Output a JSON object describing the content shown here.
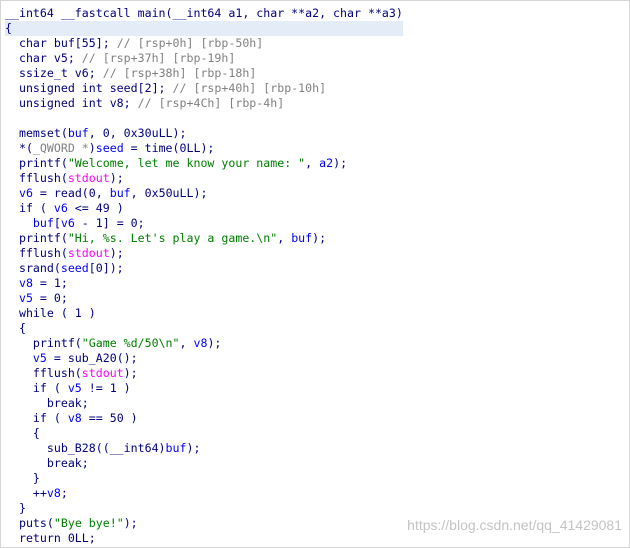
{
  "code": {
    "lines": [
      [
        [
          "p",
          "__int64 __fastcall main(__int64 a1, char **a2, char **a3)"
        ]
      ],
      [
        [
          "p",
          "{"
        ]
      ],
      [
        [
          "p",
          "  char buf[55]; "
        ],
        [
          "c",
          "// [rsp+0h] [rbp-50h]"
        ]
      ],
      [
        [
          "p",
          "  char v5; "
        ],
        [
          "c",
          "// [rsp+37h] [rbp-19h]"
        ]
      ],
      [
        [
          "p",
          "  ssize_t v6; "
        ],
        [
          "c",
          "// [rsp+38h] [rbp-18h]"
        ]
      ],
      [
        [
          "p",
          "  unsigned int seed[2]; "
        ],
        [
          "c",
          "// [rsp+40h] [rbp-10h]"
        ]
      ],
      [
        [
          "p",
          "  unsigned int v8; "
        ],
        [
          "c",
          "// [rsp+4Ch] [rbp-4h]"
        ]
      ],
      [
        [
          "p",
          ""
        ]
      ],
      [
        [
          "p",
          "  memset("
        ],
        [
          "v",
          "buf"
        ],
        [
          "p",
          ", 0, 0x30uLL);"
        ]
      ],
      [
        [
          "p",
          "  *("
        ],
        [
          "c",
          "_QWORD *"
        ],
        [
          "p",
          ")"
        ],
        [
          "v",
          "seed"
        ],
        [
          "p",
          " = time(0LL);"
        ]
      ],
      [
        [
          "p",
          "  printf("
        ],
        [
          "s",
          "\"Welcome, let me know your name: \""
        ],
        [
          "p",
          ", "
        ],
        [
          "v",
          "a2"
        ],
        [
          "p",
          ");"
        ]
      ],
      [
        [
          "p",
          "  fflush("
        ],
        [
          "g",
          "stdout"
        ],
        [
          "p",
          ");"
        ]
      ],
      [
        [
          "p",
          "  "
        ],
        [
          "v",
          "v6"
        ],
        [
          "p",
          " = read(0, "
        ],
        [
          "v",
          "buf"
        ],
        [
          "p",
          ", 0x50uLL);"
        ]
      ],
      [
        [
          "p",
          "  if ( "
        ],
        [
          "v",
          "v6"
        ],
        [
          "p",
          " <= 49 )"
        ]
      ],
      [
        [
          "p",
          "    "
        ],
        [
          "v",
          "buf"
        ],
        [
          "p",
          "["
        ],
        [
          "v",
          "v6"
        ],
        [
          "p",
          " - 1] = 0;"
        ]
      ],
      [
        [
          "p",
          "  printf("
        ],
        [
          "s",
          "\"Hi, %s. Let's play a game.\\n\""
        ],
        [
          "p",
          ", "
        ],
        [
          "v",
          "buf"
        ],
        [
          "p",
          ");"
        ]
      ],
      [
        [
          "p",
          "  fflush("
        ],
        [
          "g",
          "stdout"
        ],
        [
          "p",
          ");"
        ]
      ],
      [
        [
          "p",
          "  srand("
        ],
        [
          "v",
          "seed"
        ],
        [
          "p",
          "[0]);"
        ]
      ],
      [
        [
          "p",
          "  "
        ],
        [
          "v",
          "v8"
        ],
        [
          "p",
          " = 1;"
        ]
      ],
      [
        [
          "p",
          "  "
        ],
        [
          "v",
          "v5"
        ],
        [
          "p",
          " = 0;"
        ]
      ],
      [
        [
          "p",
          "  while ( 1 )"
        ]
      ],
      [
        [
          "p",
          "  {"
        ]
      ],
      [
        [
          "p",
          "    printf("
        ],
        [
          "s",
          "\"Game %d/50\\n\""
        ],
        [
          "p",
          ", "
        ],
        [
          "v",
          "v8"
        ],
        [
          "p",
          ");"
        ]
      ],
      [
        [
          "p",
          "    "
        ],
        [
          "v",
          "v5"
        ],
        [
          "p",
          " = sub_A20();"
        ]
      ],
      [
        [
          "p",
          "    fflush("
        ],
        [
          "g",
          "stdout"
        ],
        [
          "p",
          ");"
        ]
      ],
      [
        [
          "p",
          "    if ( "
        ],
        [
          "v",
          "v5"
        ],
        [
          "p",
          " != 1 )"
        ]
      ],
      [
        [
          "p",
          "      break;"
        ]
      ],
      [
        [
          "p",
          "    if ( "
        ],
        [
          "v",
          "v8"
        ],
        [
          "p",
          " == 50 )"
        ]
      ],
      [
        [
          "p",
          "    {"
        ]
      ],
      [
        [
          "p",
          "      sub_B28((__int64)"
        ],
        [
          "v",
          "buf"
        ],
        [
          "p",
          ");"
        ]
      ],
      [
        [
          "p",
          "      break;"
        ]
      ],
      [
        [
          "p",
          "    }"
        ]
      ],
      [
        [
          "p",
          "    ++"
        ],
        [
          "v",
          "v8"
        ],
        [
          "p",
          ";"
        ]
      ],
      [
        [
          "p",
          "  }"
        ]
      ],
      [
        [
          "p",
          "  puts("
        ],
        [
          "s",
          "\"Bye bye!\""
        ],
        [
          "p",
          ");"
        ]
      ],
      [
        [
          "p",
          "  return 0LL;"
        ]
      ]
    ],
    "highlighted_line_index": 1
  },
  "watermark": "https://blog.csdn.net/qq_41429081",
  "colors": {
    "plain_text": "#000080",
    "variable": "#0000ff",
    "comment": "#808080",
    "string": "#008000",
    "global": "#ff00ff",
    "highlight_bg": "#e4ecf8",
    "background": "#ffffff"
  }
}
